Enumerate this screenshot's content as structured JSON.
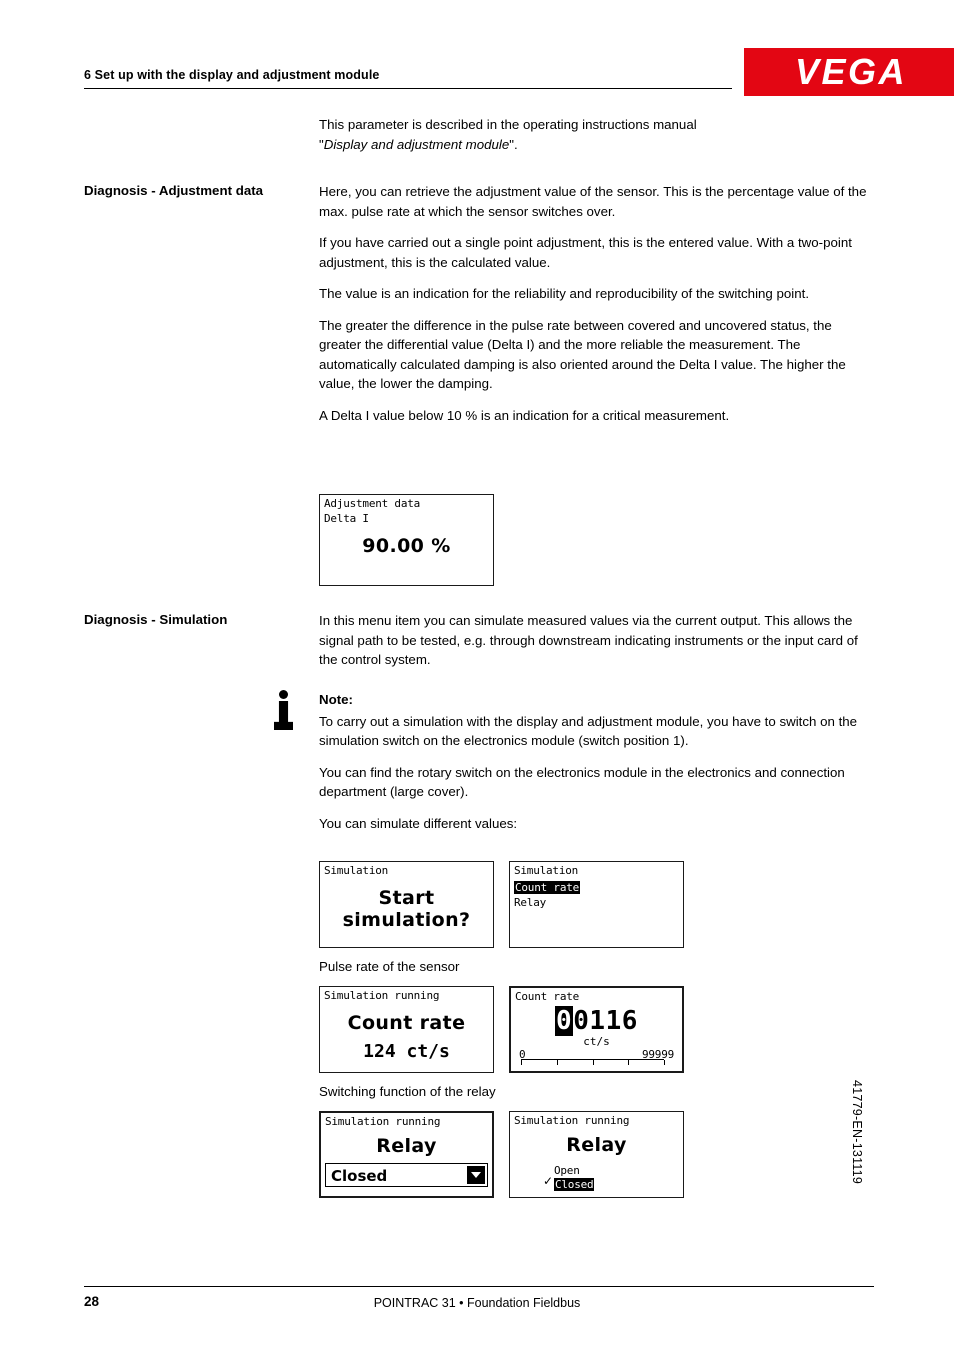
{
  "header": {
    "chapter": "6 Set up with the display and adjustment module",
    "logo": "VEGA"
  },
  "intro": {
    "line1": "This parameter is described in the operating instructions manual",
    "quote_open": "\"",
    "italic": "Display and adjustment module",
    "quote_close": "\"."
  },
  "sections": [
    {
      "label": "Diagnosis - Adjustment data",
      "paragraphs": [
        "Here, you can retrieve the adjustment value of the sensor. This is the percentage value of the max. pulse rate at which the sensor switches over.",
        "If you have carried out a single point adjustment, this is the entered value. With a two-point adjustment, this is the calculated value.",
        "The value is an indication for the reliability and reproducibility of the switching point.",
        "The greater the difference in the pulse rate between covered and uncovered status, the greater the differential value (Delta I) and the more reliable the measurement. The automatically calculated damping is also oriented around the Delta I value. The higher the value, the lower the damping.",
        "A Delta I value below 10 % is an indication for a critical measurement."
      ]
    },
    {
      "label": "Diagnosis - Simulation",
      "paragraphs": [
        "In this menu item you can simulate measured values via the current output. This allows the signal path to be tested, e.g. through downstream indicating instruments or the input card of the control system."
      ]
    }
  ],
  "note": {
    "title": "Note:",
    "paragraphs": [
      "To carry out a simulation with the display and adjustment module, you have to switch on the simulation switch on the electronics module (switch position 1).",
      "You can find the rotary switch on the electronics module in the electronics and connection department (large cover).",
      "You can simulate different values:"
    ]
  },
  "displays": {
    "adjustment": {
      "title": "Adjustment data",
      "subtitle": "Delta I",
      "value": "90.00 %"
    },
    "sim_start": {
      "title": "Simulation",
      "line1": "Start",
      "line2": "simulation?"
    },
    "sim_menu": {
      "title": "Simulation",
      "item_selected": "Count rate",
      "item_2": "Relay"
    },
    "sim_countrate": {
      "title": "Simulation running",
      "line1": "Count rate",
      "line2": "124 ct/s"
    },
    "countrate_edit": {
      "title": "Count rate",
      "value_cursor": "0",
      "value_rest": "0116",
      "unit": "ct/s",
      "scale_min": "0",
      "scale_max": "99999"
    },
    "relay_edit": {
      "title": "Simulation running",
      "line1": "Relay",
      "selected": "Closed"
    },
    "relay_select": {
      "title": "Simulation running",
      "line1": "Relay",
      "option_1": "Open",
      "option_2": "Closed",
      "check": "✓"
    }
  },
  "captions": {
    "pulse_rate": "Pulse rate of the sensor",
    "switching": "Switching function of the relay"
  },
  "footer": {
    "page": "28",
    "center": "POINTRAC 31 • Foundation Fieldbus",
    "side_code": "41779-EN-131119"
  },
  "colors": {
    "brand_red": "#e30613"
  }
}
